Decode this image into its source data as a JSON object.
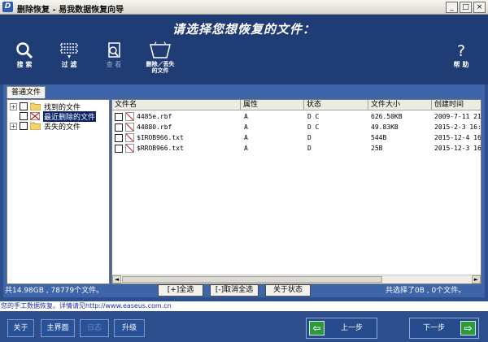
{
  "window": {
    "title": "删除恢复 - 易我数据恢复向导",
    "logo": "D",
    "minimize": "_",
    "maximize": "□",
    "close": "×"
  },
  "header": {
    "title": "请选择您想恢复的文件："
  },
  "toolbar": [
    {
      "icon": "search-icon",
      "label": "搜 索",
      "enabled": true
    },
    {
      "icon": "filter-icon",
      "label": "过 滤",
      "enabled": true
    },
    {
      "icon": "view-icon",
      "label": "查 看",
      "enabled": false
    },
    {
      "icon": "deleted-lost-icon",
      "label": "删除／丢失\n的文件",
      "enabled": true
    },
    {
      "icon": "help-icon",
      "label": "帮 助",
      "enabled": true
    }
  ],
  "tab": "普通文件",
  "tree": [
    {
      "label": "找到的文件",
      "expander": "+",
      "selected": false
    },
    {
      "label": "最近删除的文件",
      "expander": "",
      "selected": true
    },
    {
      "label": "丢失的文件",
      "expander": "+",
      "selected": false
    }
  ],
  "filelist": {
    "columns": [
      "文件名",
      "属性",
      "状态",
      "文件大小",
      "创建时间"
    ],
    "rows": [
      {
        "name": "4485e.rbf",
        "attr": "A",
        "state": "D C",
        "size": "626.50KB",
        "created": "2009-7-11 21:"
      },
      {
        "name": "44880.rbf",
        "attr": "A",
        "state": "D C",
        "size": "49.83KB",
        "created": "2015-2-3 16:5"
      },
      {
        "name": "$IROB966.txt",
        "attr": "A",
        "state": "D",
        "size": "544B",
        "created": "2015-12-4 16:"
      },
      {
        "name": "$RROB966.txt",
        "attr": "A",
        "state": "D",
        "size": "25B",
        "created": "2015-12-3 16:"
      }
    ]
  },
  "status": {
    "total": "共14.98GB , 78779个文件。",
    "selected": "共选择了0B , 0个文件。"
  },
  "panel_buttons": {
    "select_all": "[+]全选",
    "deselect_all": "[-]取消全选",
    "about_state": "关于状态"
  },
  "info_text": "您的手工数据恢复。详情请见http://www.easeus.com.cn",
  "footer": {
    "about": "关于",
    "main": "主界面",
    "log": "日志",
    "upgrade": "升级",
    "prev": "上一步",
    "next": "下一步"
  }
}
